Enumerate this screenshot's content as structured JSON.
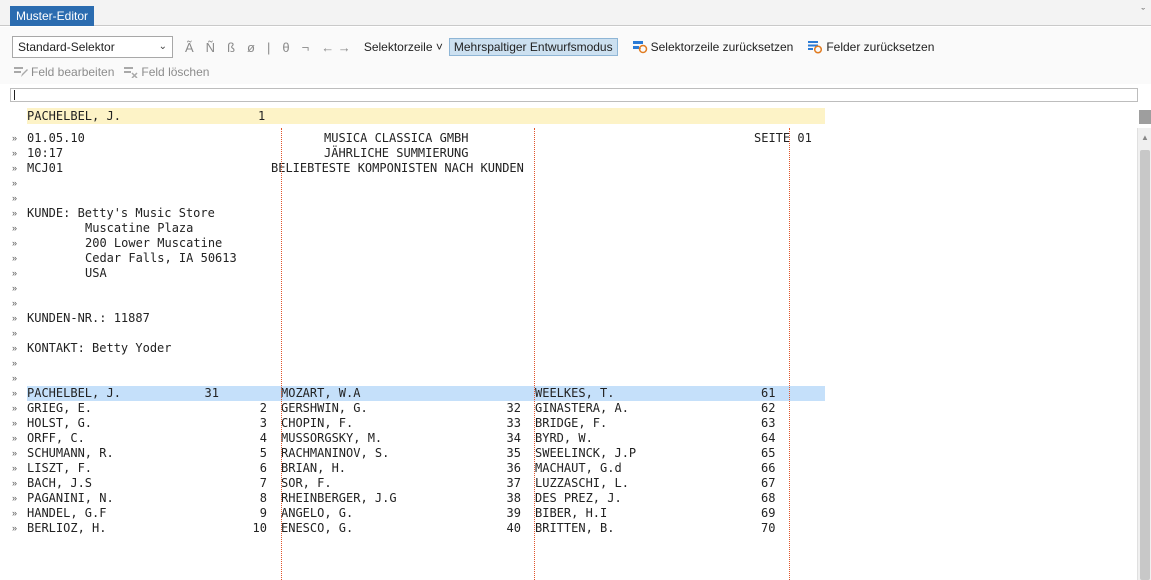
{
  "window": {
    "tab_label": "Muster-Editor",
    "collapse_glyph": "ˇ"
  },
  "toolbar": {
    "selector_value": "Standard-Selektor",
    "chars": [
      "Ã",
      "Ñ",
      "ß",
      "ø",
      "|",
      "θ",
      "¬"
    ],
    "arrows": "← →",
    "selector_row_label": "Selektorzeile ˅",
    "multicol_label": "Mehrspaltiger Entwurfsmodus",
    "reset_selector_label": "Selektorzeile zurücksetzen",
    "reset_fields_label": "Felder zurücksetzen",
    "edit_field_label": "Feld bearbeiten",
    "delete_field_label": "Feld löschen"
  },
  "header_line": {
    "name": "PACHELBEL, J.",
    "num": "1"
  },
  "report": {
    "date": "01.05.10",
    "company": "MUSICA CLASSICA GMBH",
    "page": "SEITE 01",
    "time": "10:17",
    "subtitle": "JÄHRLICHE SUMMIERUNG",
    "code": "MCJ01",
    "report_title": "BELIEBTESTE KOMPONISTEN NACH KUNDEN",
    "customer_line": "KUNDE: Betty's Music Store",
    "address": [
      "Muscatine Plaza",
      "200 Lower Muscatine",
      "Cedar Falls, IA 50613",
      "USA"
    ],
    "customer_no": "KUNDEN-NR.: 11887",
    "contact": "KONTAKT: Betty Yoder"
  },
  "gutter_marker": "»",
  "rows": [
    [
      "PACHELBEL, J.",
      "1",
      "MOZART, W.A",
      "31",
      "WEELKES, T.",
      "61"
    ],
    [
      "GRIEG, E.",
      "2",
      "GERSHWIN, G.",
      "32",
      "GINASTERA, A.",
      "62"
    ],
    [
      "HOLST, G.",
      "3",
      "CHOPIN, F.",
      "33",
      "BRIDGE, F.",
      "63"
    ],
    [
      "ORFF, C.",
      "4",
      "MUSSORGSKY, M.",
      "34",
      "BYRD, W.",
      "64"
    ],
    [
      "SCHUMANN, R.",
      "5",
      "RACHMANINOV, S.",
      "35",
      "SWEELINCK, J.P",
      "65"
    ],
    [
      "LISZT, F.",
      "6",
      "BRIAN, H.",
      "36",
      "MACHAUT, G.d",
      "66"
    ],
    [
      "BACH, J.S",
      "7",
      "SOR, F.",
      "37",
      "LUZZASCHI, L.",
      "67"
    ],
    [
      "PAGANINI, N.",
      "8",
      "RHEINBERGER, J.G",
      "38",
      "DES PREZ, J.",
      "68"
    ],
    [
      "HANDEL, G.F",
      "9",
      "ANGELO, G.",
      "39",
      "BIBER, H.I",
      "69"
    ],
    [
      "BERLIOZ, H.",
      "10",
      "ENESCO, G.",
      "40",
      "BRITTEN, B.",
      "70"
    ]
  ],
  "colors": {
    "tab": "#2b6cb0",
    "header_highlight": "#fdf3c7",
    "selected_row": "#c5e0fa",
    "column_guide": "#e0552a"
  }
}
